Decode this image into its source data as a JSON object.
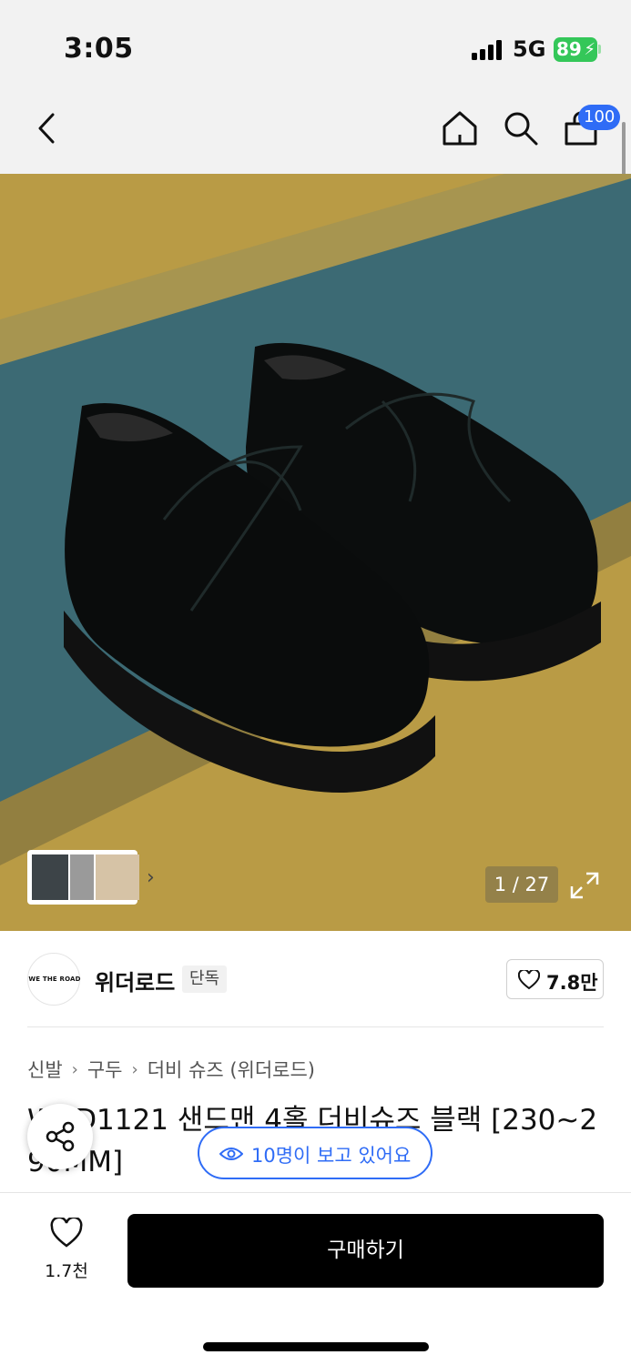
{
  "status_bar": {
    "time": "3:05",
    "network": "5G",
    "battery": "89"
  },
  "nav": {
    "back_icon": "chevron-left-icon",
    "home_icon": "home-icon",
    "search_icon": "search-icon",
    "cart_icon": "cart-icon",
    "cart_count": "100"
  },
  "gallery": {
    "counter": "1 / 27",
    "expand_icon": "expand-icon"
  },
  "brand": {
    "logo_text": "WE THE ROAD",
    "name": "위더로드",
    "badge": "단독",
    "like_count": "7.8만"
  },
  "breadcrumb": [
    "신발",
    "구두",
    "더비 슈즈 (위더로드)"
  ],
  "product": {
    "title": "WRD1121 샌드맨 4홀 더비슈즈 블랙 [230~290MM]"
  },
  "viewers_text": "10명이 보고 있어요",
  "bottom": {
    "wish_count": "1.7천",
    "buy_label": "구매하기"
  },
  "colors": {
    "accent_blue": "#2f6cf6",
    "battery_green": "#34c759",
    "buy_button": "#000000"
  }
}
